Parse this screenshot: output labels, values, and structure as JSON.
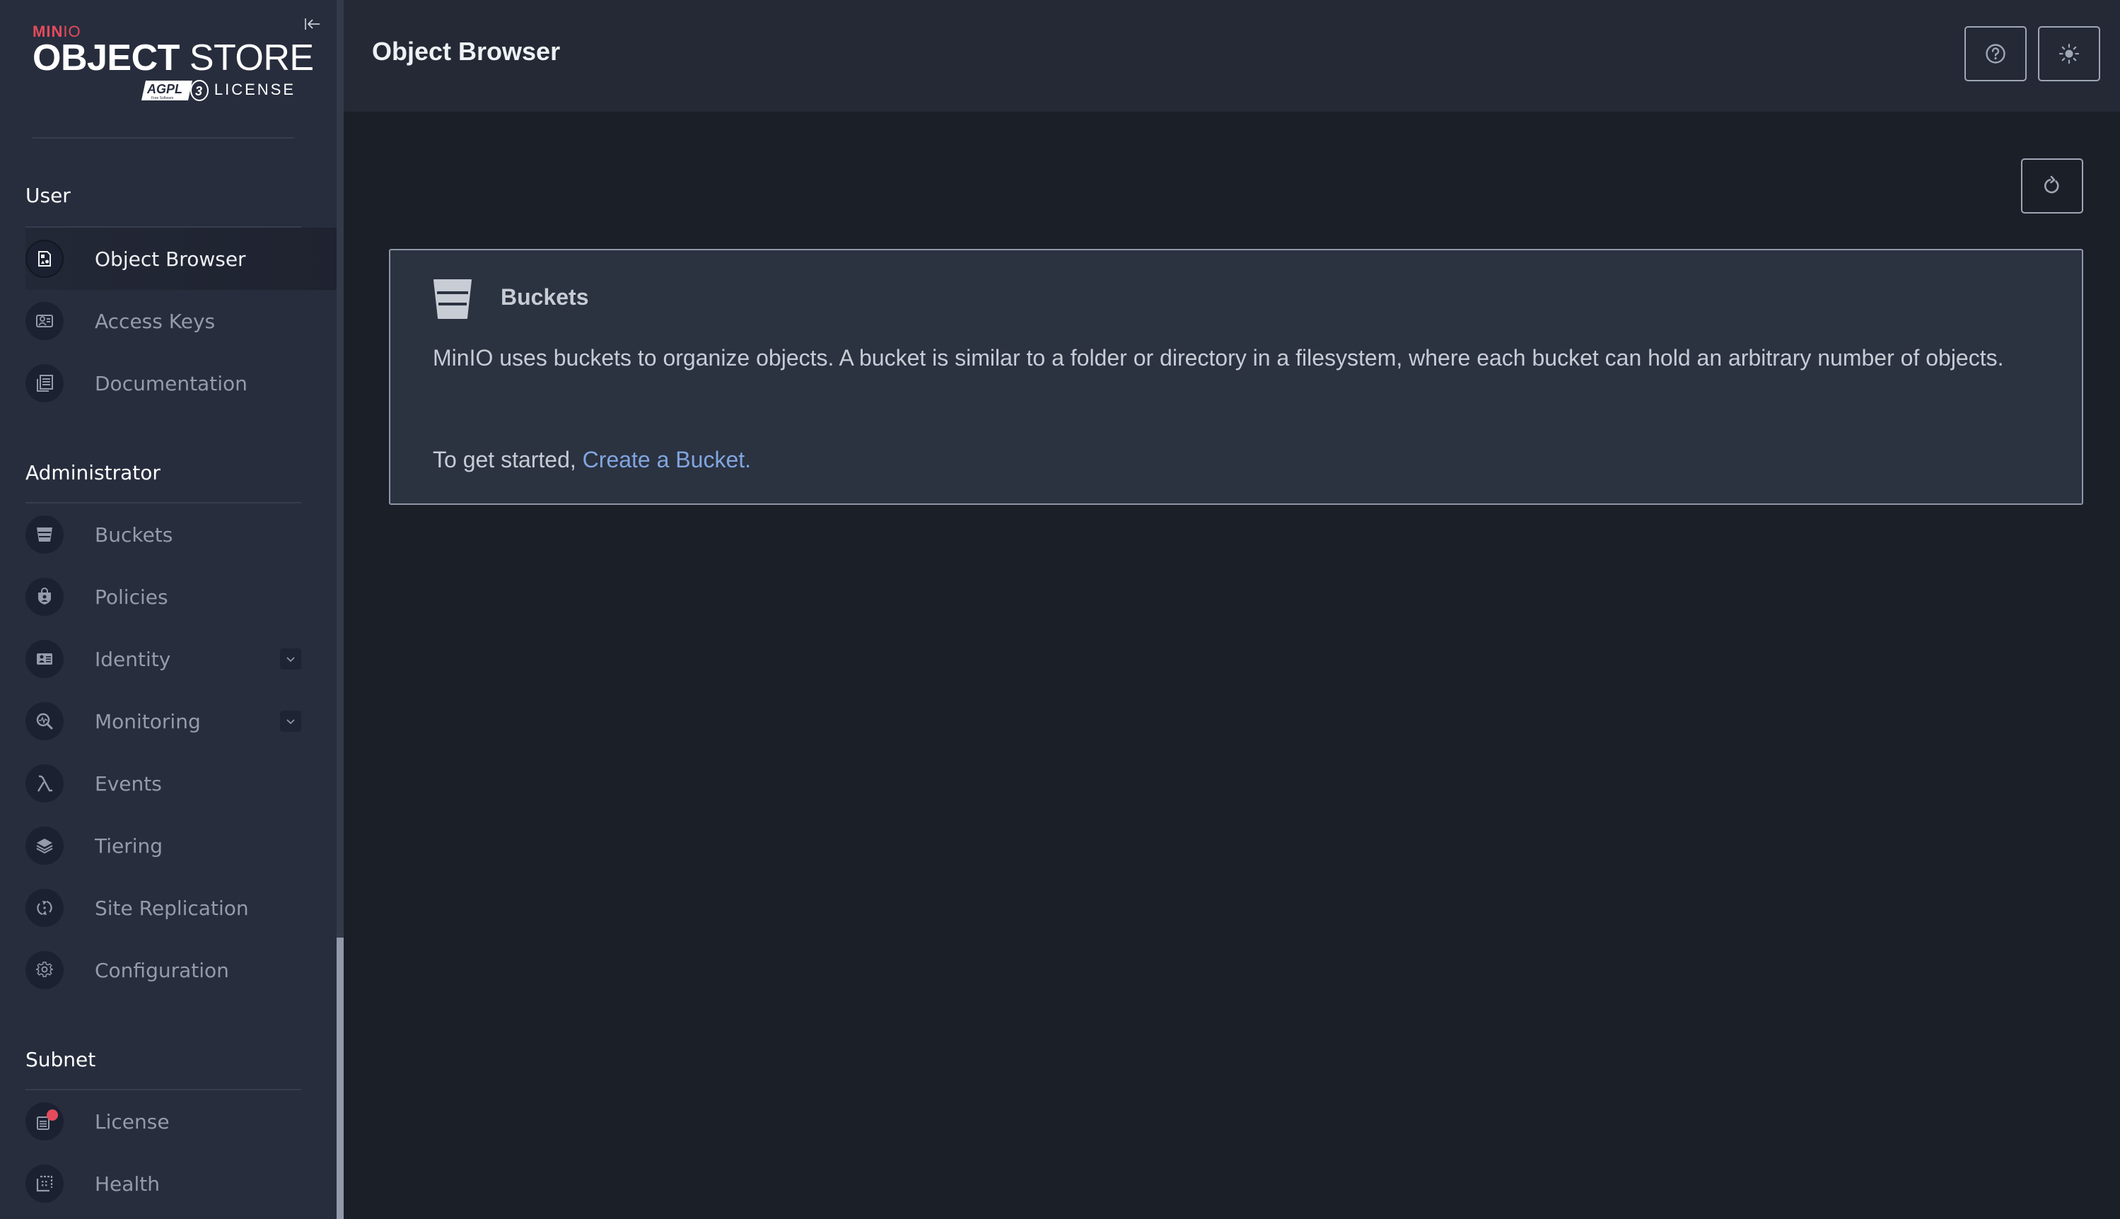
{
  "brand": {
    "minio_bold": "MIN",
    "minio_light": "IO",
    "object": "OBJECT",
    "store": "STORE",
    "agpl": "AGPL",
    "agpl_version": "3",
    "agpl_sub": "Free Software",
    "license": "LICENSE"
  },
  "colors": {
    "accent_red": "#e54b5c",
    "link_blue": "#81a5e0",
    "sidebar_bg": "#272d3d",
    "main_bg": "#1b1f28",
    "header_bg": "#242935"
  },
  "sidebar": {
    "collapse_icon": "collapse-left-icon",
    "sections": [
      {
        "title": "User",
        "items": [
          {
            "label": "Object Browser",
            "icon": "object-browser-icon",
            "active": true
          },
          {
            "label": "Access Keys",
            "icon": "access-keys-icon"
          },
          {
            "label": "Documentation",
            "icon": "documentation-icon"
          }
        ]
      },
      {
        "title": "Administrator",
        "items": [
          {
            "label": "Buckets",
            "icon": "bucket-icon"
          },
          {
            "label": "Policies",
            "icon": "policies-icon"
          },
          {
            "label": "Identity",
            "icon": "identity-icon",
            "expandable": true
          },
          {
            "label": "Monitoring",
            "icon": "monitoring-icon",
            "expandable": true
          },
          {
            "label": "Events",
            "icon": "lambda-icon"
          },
          {
            "label": "Tiering",
            "icon": "tiering-icon"
          },
          {
            "label": "Site Replication",
            "icon": "site-replication-icon"
          },
          {
            "label": "Configuration",
            "icon": "gear-icon"
          }
        ]
      },
      {
        "title": "Subnet",
        "items": [
          {
            "label": "License",
            "icon": "license-icon",
            "notification": true
          },
          {
            "label": "Health",
            "icon": "health-icon"
          }
        ]
      }
    ]
  },
  "header": {
    "title": "Object Browser",
    "help_icon": "help-icon",
    "theme_icon": "sun-icon"
  },
  "main": {
    "refresh_icon": "refresh-icon",
    "card": {
      "title": "Buckets",
      "body": "MinIO uses buckets to organize objects. A bucket is similar to a folder or directory in a filesystem, where each bucket can hold an arbitrary number of objects.",
      "cta_prefix": "To get started, ",
      "cta_link": "Create a Bucket."
    }
  }
}
